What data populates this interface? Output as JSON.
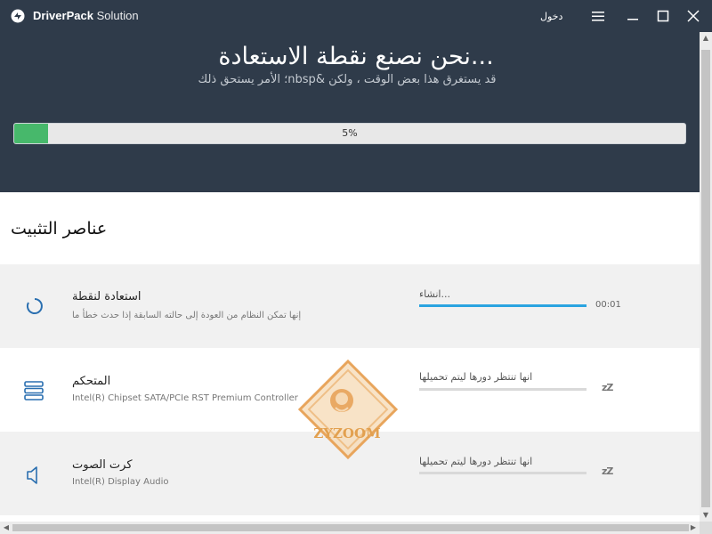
{
  "app": {
    "brand_bold": "DriverPack",
    "brand_light": "Solution",
    "login_label": "دخول"
  },
  "header": {
    "headline": "...نحن نصنع نقطة الاستعادة",
    "subline": "؛ الأمر يستحق ذلكnbsp& قد يستغرق هذا بعض الوقت ، ولكن",
    "progress_percent": 5,
    "progress_label": "5%"
  },
  "section": {
    "title": "عناصر التثبيت"
  },
  "items": [
    {
      "title": "استعادة لنقطة",
      "subtitle": "إنها تمكن النظام من العودة إلى حالته السابقة إذا حدث خطأ ما",
      "status": "...انشاء",
      "progress": 1.0,
      "time": "00:01",
      "icon": "spinner-icon"
    },
    {
      "title": "المتحكم",
      "subtitle": "Intel(R) Chipset SATA/PCIe RST Premium Controller",
      "status": "انها تنتظر دورها ليتم تحميلها",
      "progress": 0,
      "zz": "zZ",
      "icon": "controller-icon"
    },
    {
      "title": "كرت الصوت",
      "subtitle": "Intel(R) Display Audio",
      "status": "انها تنتظر دورها ليتم تحميلها",
      "progress": 0,
      "zz": "zZ",
      "icon": "speaker-icon"
    }
  ],
  "watermark": {
    "text": "ZYZOOM"
  },
  "colors": {
    "header_bg": "#2f3b4a",
    "accent_green": "#47b86b",
    "accent_blue": "#2aa4e0",
    "row_gray": "#f1f1f1",
    "watermark": "#e2a04f"
  }
}
